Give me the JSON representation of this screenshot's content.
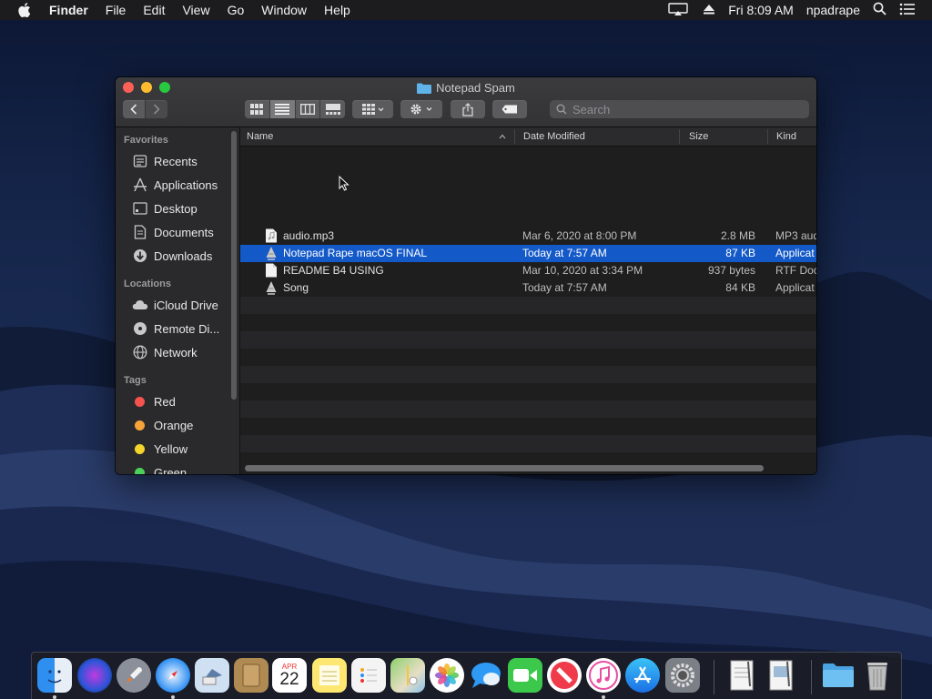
{
  "menubar": {
    "app": "Finder",
    "items": [
      "File",
      "Edit",
      "View",
      "Go",
      "Window",
      "Help"
    ],
    "clock": "Fri 8:09 AM",
    "user": "npadrape",
    "icons": [
      "apple-icon",
      "airplay-display-icon",
      "eject-icon",
      "spotlight-search-icon",
      "notification-center-icon"
    ]
  },
  "window": {
    "title": "Notepad Spam",
    "search_placeholder": "Search",
    "toolbar": {
      "view_modes": [
        "icon-view",
        "list-view",
        "column-view",
        "gallery-view"
      ],
      "active_view": "list-view"
    }
  },
  "sidebar": {
    "favorites_header": "Favorites",
    "favorites": [
      {
        "label": "Recents",
        "icon": "recents-icon"
      },
      {
        "label": "Applications",
        "icon": "applications-icon"
      },
      {
        "label": "Desktop",
        "icon": "desktop-icon"
      },
      {
        "label": "Documents",
        "icon": "documents-icon"
      },
      {
        "label": "Downloads",
        "icon": "downloads-icon"
      }
    ],
    "locations_header": "Locations",
    "locations": [
      {
        "label": "iCloud Drive",
        "icon": "icloud-icon"
      },
      {
        "label": "Remote Di...",
        "icon": "remote-disc-icon"
      },
      {
        "label": "Network",
        "icon": "network-icon"
      }
    ],
    "tags_header": "Tags",
    "tags": [
      {
        "label": "Red",
        "color": "#f6534e"
      },
      {
        "label": "Orange",
        "color": "#f6a33a"
      },
      {
        "label": "Yellow",
        "color": "#f5d52b"
      },
      {
        "label": "Green",
        "color": "#4bd15a"
      }
    ]
  },
  "list": {
    "columns": {
      "name": "Name",
      "date": "Date Modified",
      "size": "Size",
      "kind": "Kind"
    },
    "rows": [
      {
        "name": "audio.mp3",
        "date": "Mar 6, 2020 at 8:00 PM",
        "size": "2.8 MB",
        "kind": "MP3 aud",
        "icon": "audio-file-icon",
        "selected": false
      },
      {
        "name": "Notepad Rape macOS FINAL",
        "date": "Today at 7:57 AM",
        "size": "87 KB",
        "kind": "Applicat",
        "icon": "application-icon",
        "selected": true
      },
      {
        "name": "README B4 USING",
        "date": "Mar 10, 2020 at 3:34 PM",
        "size": "937 bytes",
        "kind": "RTF Doc",
        "icon": "document-icon",
        "selected": false
      },
      {
        "name": "Song",
        "date": "Today at 7:57 AM",
        "size": "84 KB",
        "kind": "Applicat",
        "icon": "application-icon",
        "selected": false
      }
    ]
  },
  "dock": {
    "calendar_month": "APR",
    "calendar_day": "22",
    "apps": [
      "finder",
      "siri",
      "launchpad",
      "safari",
      "mail",
      "contacts",
      "calendar",
      "notes",
      "reminders",
      "maps",
      "photos",
      "messages",
      "facetime",
      "news",
      "itunes",
      "app-store",
      "system-preferences",
      "textedit",
      "preview",
      "downloads-folder",
      "trash"
    ]
  }
}
